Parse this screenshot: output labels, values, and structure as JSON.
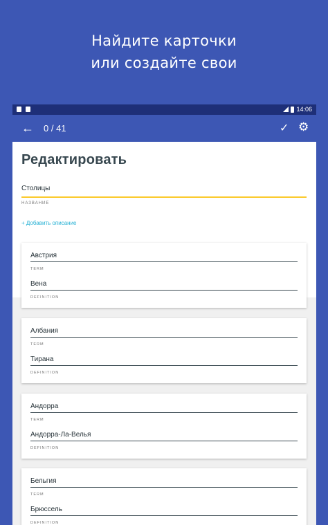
{
  "promo": {
    "line1": "Найдите карточки",
    "line2": "или создайте свои"
  },
  "statusbar": {
    "time": "14:06"
  },
  "appbar": {
    "counter": "0 / 41"
  },
  "editor": {
    "title": "Редактировать",
    "name_value": "Столицы",
    "name_label": "НАЗВАНИЕ",
    "add_description": "+ Добавить описание"
  },
  "cards": [
    {
      "term": "Австрия",
      "term_label": "TERM",
      "definition": "Вена",
      "definition_label": "DEFINITION"
    },
    {
      "term": "Албания",
      "term_label": "TERM",
      "definition": "Ти͏ра͏на",
      "definition_label": "DEFINITION"
    },
    {
      "term": "Андорра",
      "term_label": "TERM",
      "definition": "Андорра-Ла-Велья",
      "definition_label": "DEFINITION"
    },
    {
      "term": "Бельгия",
      "term_label": "TERM",
      "definition": "Брюссель",
      "definition_label": "DEFINITION"
    }
  ],
  "colors": {
    "brand": "#3d57b4",
    "status_bar": "#1e2f78",
    "accent_underline": "#fbc92b",
    "link": "#26b1d4"
  }
}
